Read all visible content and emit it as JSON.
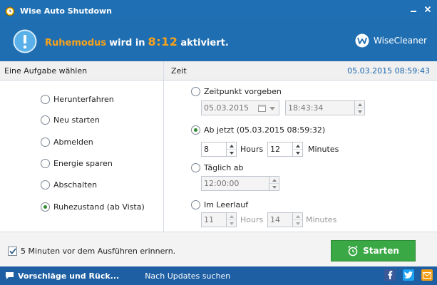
{
  "window": {
    "title": "Wise Auto Shutdown"
  },
  "banner": {
    "task": "Ruhemodus",
    "mid_text": "wird in",
    "hours": "8",
    "separator": ":",
    "minutes": "12",
    "end_text": "aktiviert.",
    "brand": "WiseCleaner"
  },
  "header": {
    "left": "Eine Aufgabe wählen",
    "right": "Zeit",
    "current_time": "05.03.2015 08:59:43"
  },
  "tasks": [
    {
      "label": "Herunterfahren",
      "checked": false
    },
    {
      "label": "Neu starten",
      "checked": false
    },
    {
      "label": "Abmelden",
      "checked": false
    },
    {
      "label": "Energie sparen",
      "checked": false
    },
    {
      "label": "Abschalten",
      "checked": false
    },
    {
      "label": "Ruhezustand (ab Vista)",
      "checked": true
    }
  ],
  "time": {
    "specified": {
      "label": "Zeitpunkt vorgeben",
      "date": "05.03.2015",
      "time": "18:43:34"
    },
    "from_now": {
      "label": "Ab jetzt (05.03.2015 08:59:32)",
      "hours": "8",
      "hours_label": "Hours",
      "minutes": "12",
      "minutes_label": "Minutes"
    },
    "daily": {
      "label": "Täglich ab",
      "time": "12:00:00"
    },
    "idle": {
      "label": "Im Leerlauf",
      "hours": "11",
      "hours_label": "Hours",
      "minutes": "14",
      "minutes_label": "Minutes"
    }
  },
  "reminder": {
    "label": "5 Minuten vor dem Ausführen erinnern.",
    "checked": true
  },
  "start_button": {
    "label": "Starten"
  },
  "footer": {
    "feedback": "Vorschläge und Rück...",
    "updates": "Nach Updates suchen"
  },
  "colors": {
    "titlebar": "#1e6fb3",
    "accent": "#f9a21b",
    "start": "#3aa844",
    "facebook": "#3b5998",
    "twitter": "#1da1f2",
    "email": "#f39c12"
  }
}
